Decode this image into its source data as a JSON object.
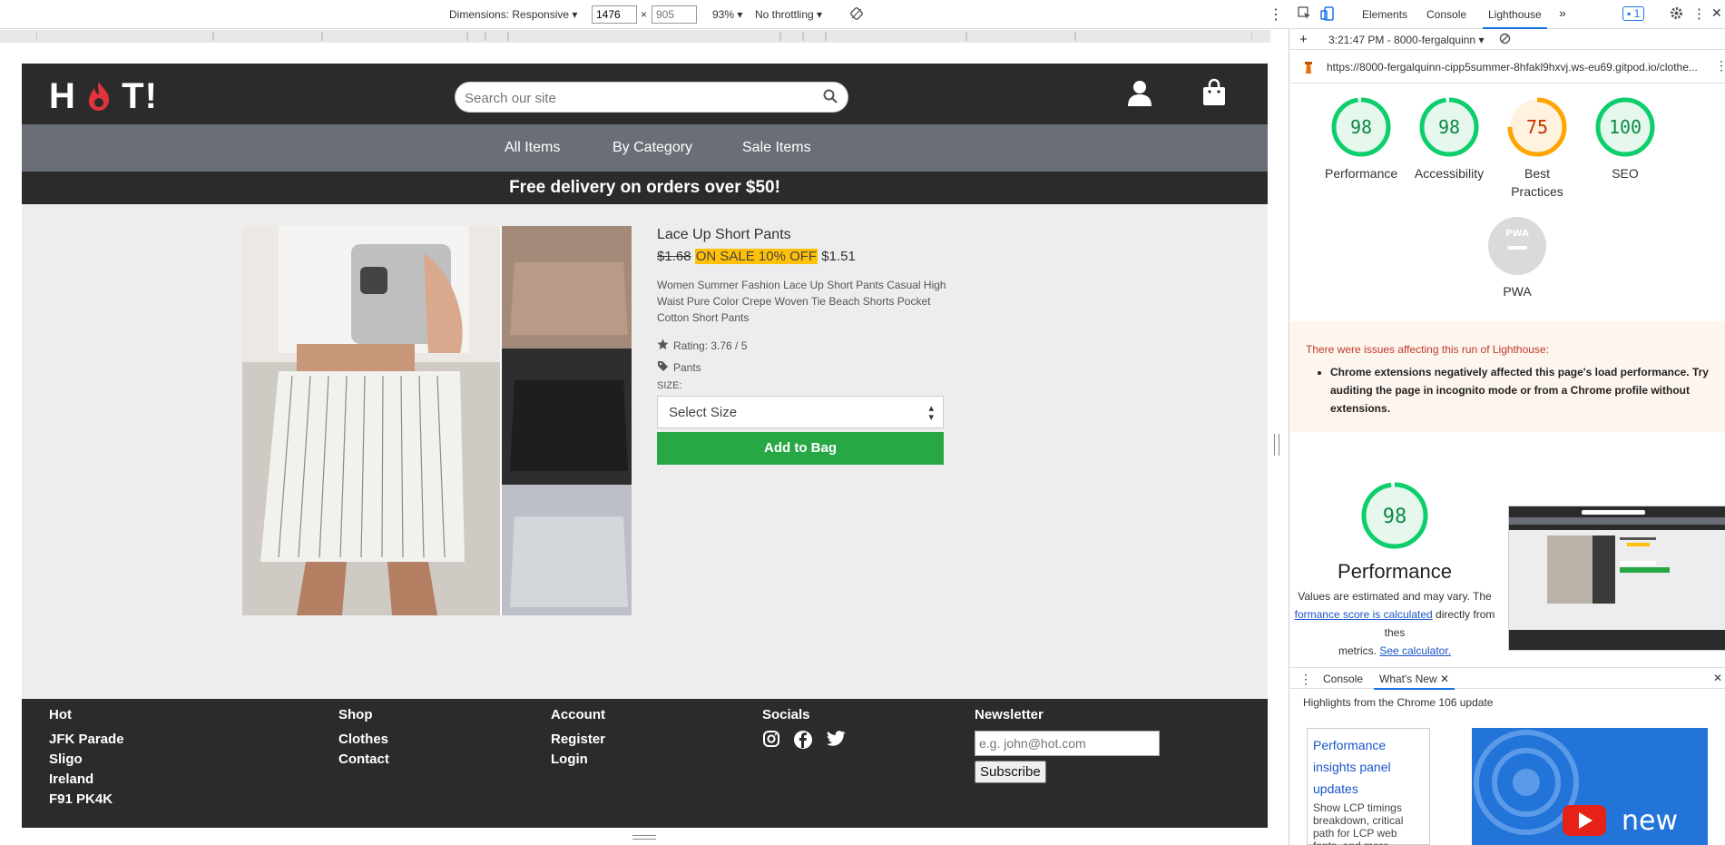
{
  "devtools_toolbar": {
    "dimensions_label": "Dimensions: Responsive",
    "width_value": "1476",
    "height_placeholder": "905",
    "times": "×",
    "zoom": "93%",
    "throttling": "No throttling"
  },
  "site": {
    "logo_text_1": "H",
    "logo_text_2": "T!",
    "search_placeholder": "Search our site",
    "nav": [
      "All Items",
      "By Category",
      "Sale Items"
    ],
    "banner": "Free delivery on orders over $50!"
  },
  "product": {
    "title": "Lace Up Short Pants",
    "old_price": "$1.68",
    "sale_badge": "ON SALE 10% OFF",
    "new_price": "$1.51",
    "description": "Women Summer Fashion Lace Up Short Pants Casual High Waist Pure Color Crepe Woven Tie Beach Shorts Pocket Cotton Short Pants",
    "rating": "Rating: 3.76 / 5",
    "category": "Pants",
    "size_label": "SIZE:",
    "size_select": "Select Size",
    "add_button": "Add to Bag"
  },
  "footer": {
    "col1": {
      "heading": "Hot",
      "lines": [
        "JFK Parade",
        "Sligo",
        "Ireland",
        "F91 PK4K"
      ]
    },
    "col2": {
      "heading": "Shop",
      "lines": [
        "Clothes",
        "Contact"
      ]
    },
    "col3": {
      "heading": "Account",
      "lines": [
        "Register",
        "Login"
      ]
    },
    "col4": {
      "heading": "Socials"
    },
    "col5": {
      "heading": "Newsletter",
      "placeholder": "e.g. john@hot.com",
      "button": "Subscribe"
    }
  },
  "devtools": {
    "tabs": [
      "Elements",
      "Console",
      "Lighthouse"
    ],
    "more": "»",
    "badge": "1",
    "report_time": "3:21:47 PM - 8000-fergalquinn",
    "url": "https://8000-fergalquinn-cipp5summer-8hfakl9hxvj.ws-eu69.gitpod.io/clothe...",
    "scores": [
      {
        "value": "98",
        "label": "Performance",
        "color": "#0cce6b"
      },
      {
        "value": "98",
        "label": "Accessibility",
        "color": "#0cce6b"
      },
      {
        "value": "75",
        "label": "Best Practices",
        "color": "#ffa400"
      },
      {
        "value": "100",
        "label": "SEO",
        "color": "#0cce6b"
      }
    ],
    "pwa_label": "PWA",
    "pwa_badge": "PWA",
    "issues_title": "There were issues affecting this run of Lighthouse:",
    "issue_1": "Chrome extensions negatively affected this page's load performance. Try auditing the page in incognito mode or from a Chrome profile without extensions.",
    "perf_score": "98",
    "perf_title": "Performance",
    "perf_note_1": "Values are estimated and may vary. The",
    "perf_link_1": "formance score is calculated",
    "perf_note_2": "directly from thes",
    "perf_note_3": "metrics.",
    "perf_link_2": "See calculator.",
    "drawer_tabs": [
      "Console",
      "What's New"
    ],
    "whats_new_title": "Highlights from the Chrome 106 update",
    "card_title": "Performance insights panel updates",
    "card_desc": "Show LCP timings breakdown, critical path for LCP web fonts, and more.",
    "video_text": "new"
  }
}
